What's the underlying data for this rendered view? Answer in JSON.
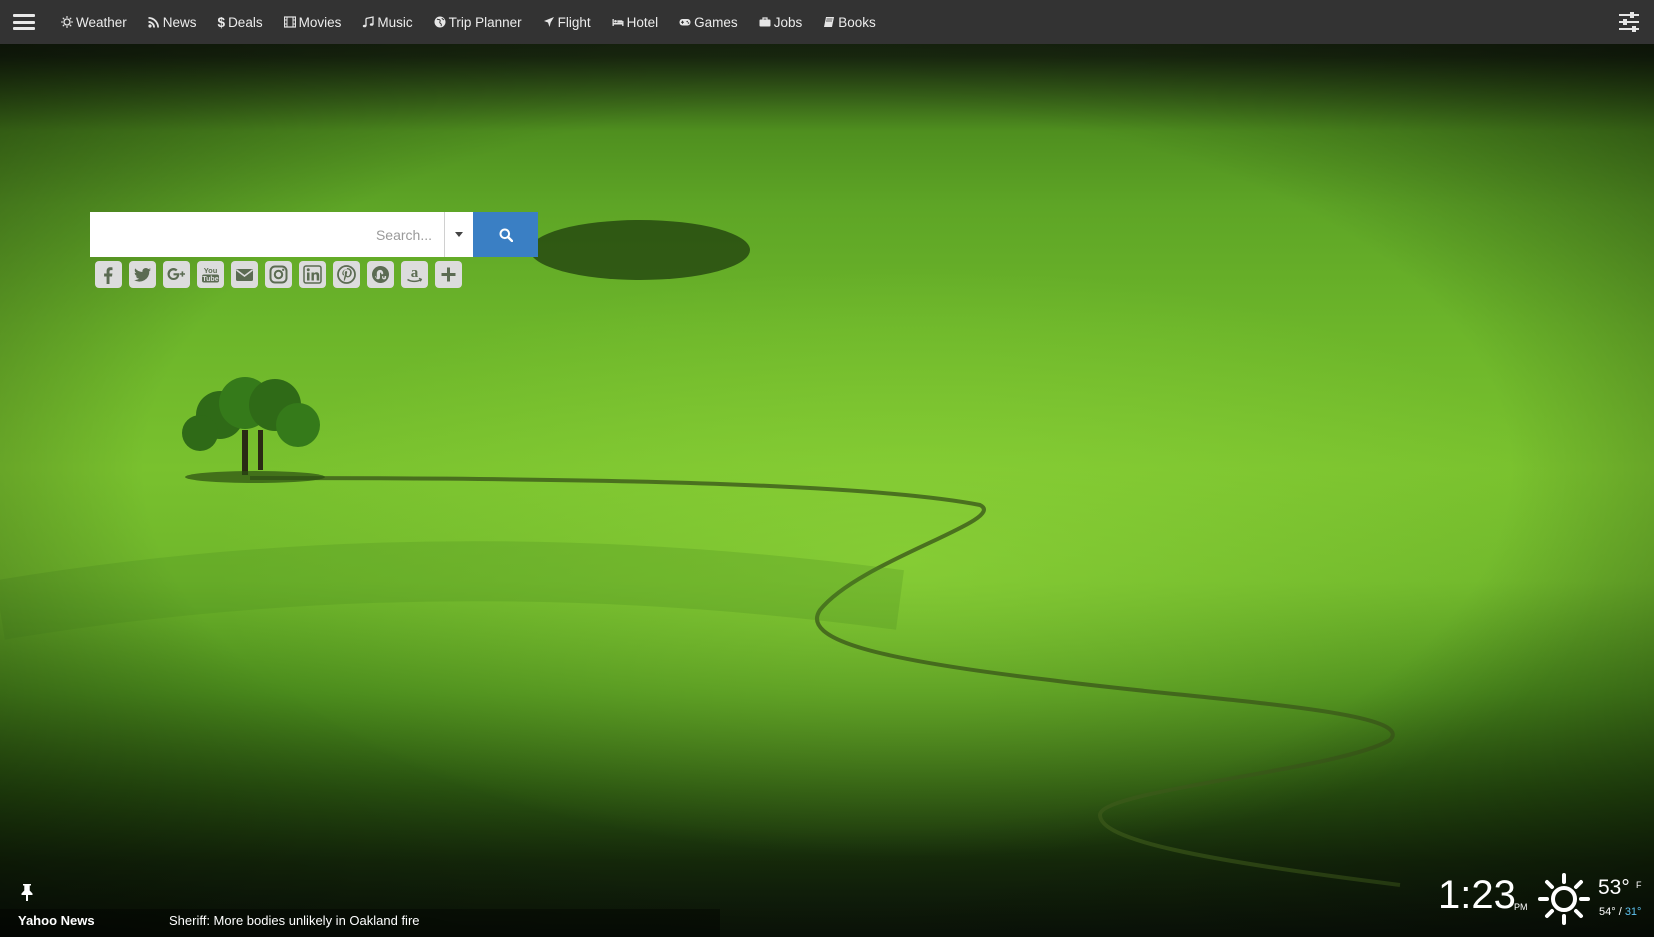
{
  "nav": {
    "items": [
      {
        "label": "Weather",
        "icon": "sun-icon"
      },
      {
        "label": "News",
        "icon": "rss-icon"
      },
      {
        "label": "Deals",
        "icon": "dollar-icon"
      },
      {
        "label": "Movies",
        "icon": "film-icon"
      },
      {
        "label": "Music",
        "icon": "music-icon"
      },
      {
        "label": "Trip Planner",
        "icon": "globe-icon"
      },
      {
        "label": "Flight",
        "icon": "plane-icon"
      },
      {
        "label": "Hotel",
        "icon": "bed-icon"
      },
      {
        "label": "Games",
        "icon": "gamepad-icon"
      },
      {
        "label": "Jobs",
        "icon": "briefcase-icon"
      },
      {
        "label": "Books",
        "icon": "book-icon"
      }
    ]
  },
  "search": {
    "placeholder": "Search..."
  },
  "social": {
    "items": [
      {
        "icon": "facebook-icon"
      },
      {
        "icon": "twitter-icon"
      },
      {
        "icon": "google-plus-icon"
      },
      {
        "icon": "youtube-icon",
        "label": "You\nTube"
      },
      {
        "icon": "email-icon"
      },
      {
        "icon": "instagram-icon"
      },
      {
        "icon": "linkedin-icon"
      },
      {
        "icon": "pinterest-icon"
      },
      {
        "icon": "stumbleupon-icon"
      },
      {
        "icon": "amazon-icon"
      },
      {
        "icon": "add-icon"
      }
    ]
  },
  "news": {
    "source": "Yahoo News",
    "headline": "Sheriff: More bodies unlikely in Oakland fire"
  },
  "clock": {
    "time": "1:23",
    "ampm": "PM"
  },
  "weather": {
    "current": "53°",
    "unit": "F",
    "high": "54°",
    "separator": " / ",
    "low": "31°"
  },
  "colors": {
    "topbar": "#333333",
    "search_button": "#3a7fc4",
    "low_temp": "#5ec3f0"
  }
}
